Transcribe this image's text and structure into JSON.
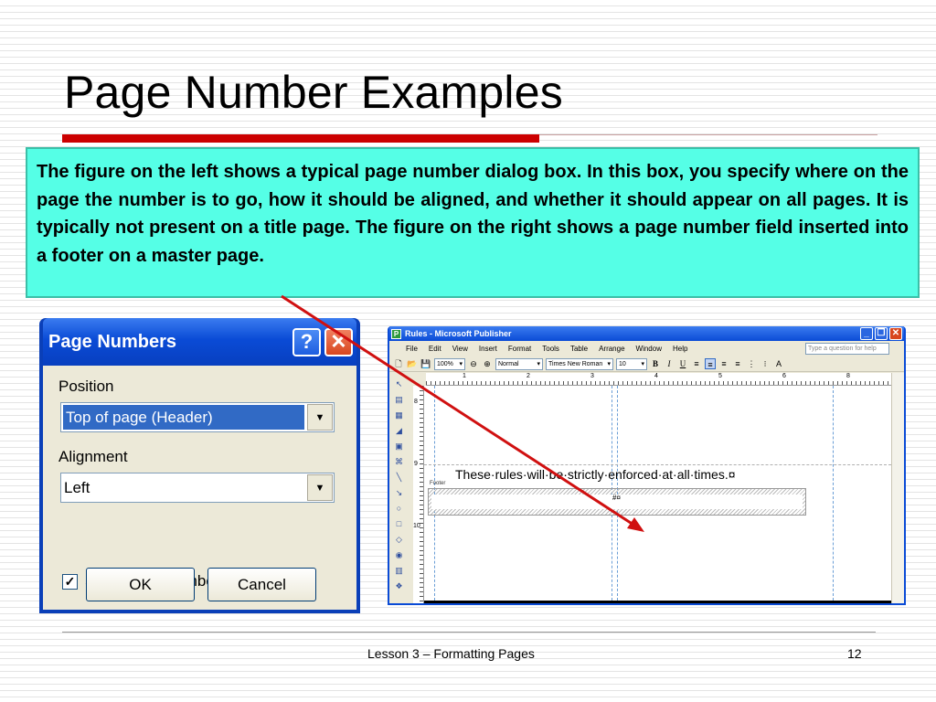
{
  "slide": {
    "title": "Page Number Examples",
    "body": "The figure on the left shows a typical page number dialog box. In this box, you specify where on the page the number is to go, how it should be aligned, and whether it should appear on all pages. It is typically not present on a title page. The figure on the right shows a page number field inserted into a footer on a master page.",
    "footer": "Lesson 3 – Formatting Pages",
    "page_number": "12",
    "accent_color": "#cc0000",
    "callout_color": "#55ffe6"
  },
  "dialog": {
    "title": "Page Numbers",
    "help_icon": "?",
    "close_icon": "✕",
    "position_label": "Position",
    "position_value": "Top of page (Header)",
    "alignment_label": "Alignment",
    "alignment_value": "Left",
    "show_first_page_label": "Show page number on first page",
    "show_first_page_checked": true,
    "ok_label": "OK",
    "cancel_label": "Cancel"
  },
  "publisher": {
    "window_title": "Rules - Microsoft Publisher",
    "menus": [
      "File",
      "Edit",
      "View",
      "Insert",
      "Format",
      "Tools",
      "Table",
      "Arrange",
      "Window",
      "Help"
    ],
    "help_placeholder": "Type a question for help",
    "zoom": "100%",
    "style": "Normal",
    "font": "Times New Roman",
    "font_size": "10",
    "ruler_h": [
      "1",
      "2",
      "3",
      "4",
      "5",
      "6",
      "7",
      "8"
    ],
    "ruler_v": [
      "8",
      "9",
      "10"
    ],
    "doc_text": "These·rules·will·be·strictly·enforced·at·all·times.¤",
    "footer_label": "Footer",
    "page_field": "#¤"
  }
}
